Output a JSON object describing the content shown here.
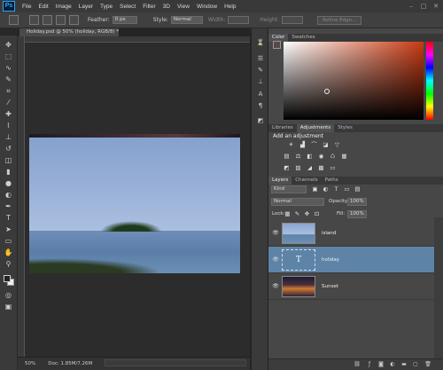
{
  "app": {
    "logo": "Ps"
  },
  "menu": [
    "File",
    "Edit",
    "Image",
    "Layer",
    "Type",
    "Select",
    "Filter",
    "3D",
    "View",
    "Window",
    "Help"
  ],
  "window_controls": {
    "minimize": "–",
    "maximize": "□",
    "close": "✕"
  },
  "options": {
    "feather_label": "Feather:",
    "feather_value": "0 px",
    "style_label": "Style:",
    "style_value": "Normal",
    "width_label": "Width:",
    "height_label": "Height:",
    "refine_label": "Refine Edge..."
  },
  "document": {
    "tab_title": "Holiday.psd @ 50% (holiday, RGB/8) *",
    "zoom": "50%",
    "doc_size": "Doc: 1.85M/7.26M"
  },
  "color_panel": {
    "tabs": [
      "Color",
      "Swatches"
    ],
    "accent": "#c83a12"
  },
  "adjustments_panel": {
    "tabs": [
      "Libraries",
      "Adjustments",
      "Styles"
    ],
    "title": "Add an adjustment"
  },
  "layers_panel": {
    "tabs": [
      "Layers",
      "Channels",
      "Paths"
    ],
    "filter_value": "Kind",
    "blend_mode": "Normal",
    "opacity_label": "Opacity:",
    "opacity_value": "100%",
    "lock_label": "Lock:",
    "fill_label": "Fill:",
    "fill_value": "100%",
    "layers": [
      {
        "name": "island",
        "type": "image",
        "selected": false
      },
      {
        "name": "holiday",
        "type": "text",
        "thumb_glyph": "T",
        "selected": true
      },
      {
        "name": "Sunset",
        "type": "image",
        "selected": false
      }
    ]
  }
}
